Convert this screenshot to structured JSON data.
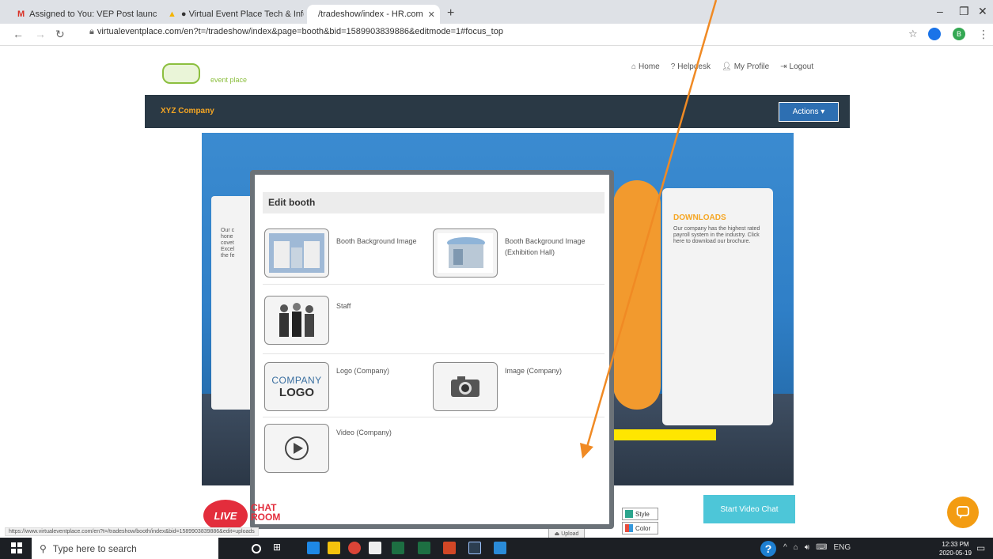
{
  "browser": {
    "tabs": [
      {
        "title": "Assigned to You: VEP Post launc",
        "icon": "gmail-icon"
      },
      {
        "title": "● Virtual Event Place Tech & Info",
        "icon": "apps-icon"
      },
      {
        "title": "/tradeshow/index - HR.com",
        "icon": "hrcom-icon"
      }
    ],
    "url": "virtualeventplace.com/en?t=/tradeshow/index&page=booth&bid=1589903839886&editmode=1#focus_top",
    "profile_initial": "B"
  },
  "site": {
    "logo_text": "event place",
    "nav": [
      "Home",
      "Helpdesk",
      "My Profile",
      "Logout"
    ],
    "company_name": "XYZ Company",
    "actions_label": "Actions ▾"
  },
  "booth": {
    "left_panel_text": "Our c\nhone\ncovet\nExcel\nthe fe",
    "downloads_heading": "DOWNLOADS",
    "downloads_text": "Our company has the highest rated payroll system in the industry. Click here to download our brochure.",
    "style_label": "Style",
    "color_label": "Color",
    "upload_label": "Upload"
  },
  "modal": {
    "title": "Edit booth",
    "items": {
      "booth_bg": "Booth Background Image",
      "booth_bg_hall": "Booth Background Image\n(Exhibition Hall)",
      "staff": "Staff",
      "logo": "Logo (Company)",
      "image": "Image (Company)",
      "video": "Video (Company)"
    },
    "logo_tile_text_1": "COMPANY",
    "logo_tile_text_2": "LOGO"
  },
  "bottom": {
    "live_label": "LIVE",
    "chat_room_label": "CHAT\nROOM",
    "video_chat_label": "Start Video Chat",
    "status_url": "https://www.virtualeventplace.com/en?t=/tradeshow/booth/index&bid=1589903839886&edit=uploads"
  },
  "taskbar": {
    "search_placeholder": "Type here to search",
    "time": "12:33 PM",
    "date": "2020-05-19",
    "lang": "ENG"
  },
  "colors": {
    "accent_orange": "#f5a623",
    "header_dark": "#2a3945",
    "actions_blue": "#2d6fb2",
    "video_chat": "#4dc6d8",
    "arrow": "#f08a24"
  }
}
